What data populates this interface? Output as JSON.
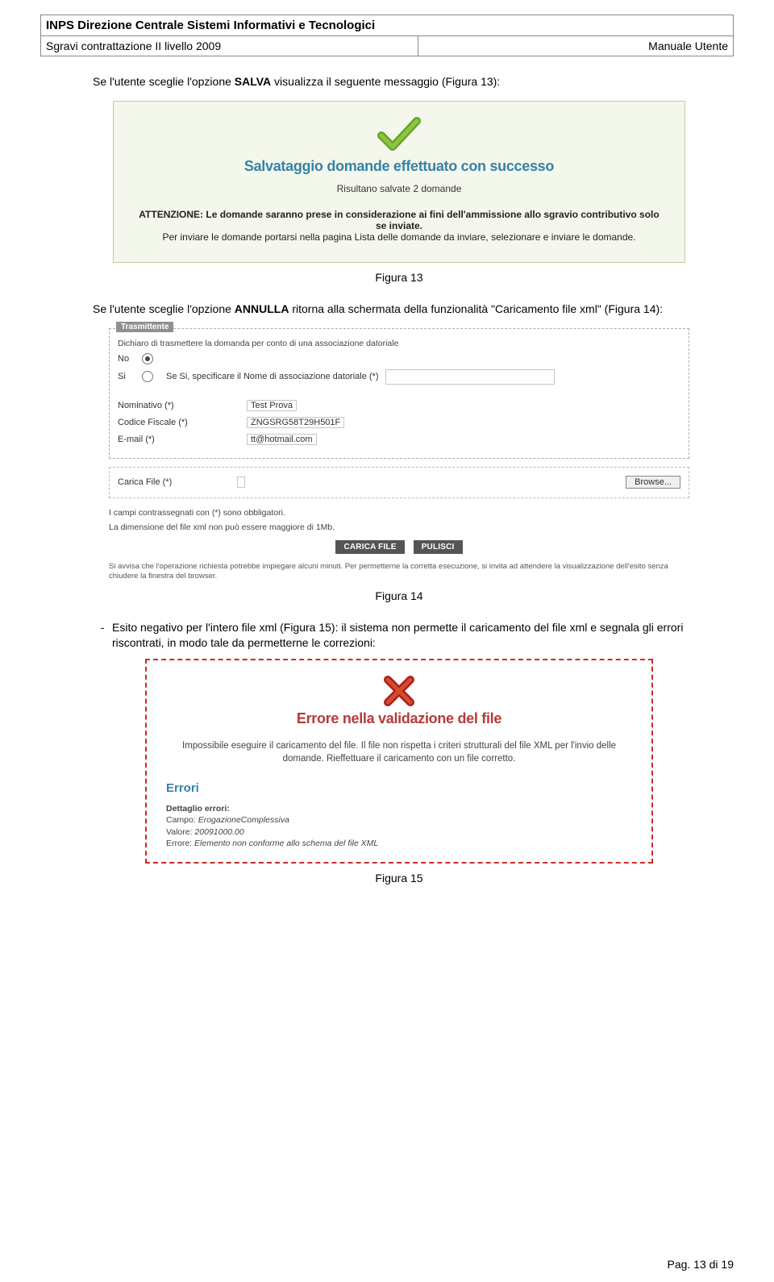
{
  "header": {
    "org": "INPS Direzione Centrale Sistemi Informativi e Tecnologici",
    "left": "Sgravi contrattazione II livello 2009",
    "right": "Manuale Utente"
  },
  "intro_before_bold": "Se l'utente sceglie l'opzione ",
  "intro_bold": "SALVA",
  "intro_after_bold": " visualizza il seguente messaggio (Figura 13):",
  "success": {
    "title": "Salvataggio domande effettuato con successo",
    "sub": "Risultano salvate 2 domande",
    "note_bold": "ATTENZIONE: Le domande saranno prese in considerazione ai fini dell'ammissione allo sgravio contributivo solo se inviate.",
    "note_rest": "Per inviare le domande portarsi nella pagina Lista delle domande da inviare, selezionare e inviare le domande."
  },
  "fig13": "Figura 13",
  "para2_before": "Se l'utente sceglie l'opzione ",
  "para2_bold": "ANNULLA",
  "para2_after": " ritorna alla schermata della funzionalità \"Caricamento file xml\" (Figura 14):",
  "form": {
    "legend": "Trasmittente",
    "decl": "Dichiaro di trasmettere la domanda per conto di una associazione datoriale",
    "no": "No",
    "si": "Si",
    "si_note": "Se Si, specificare il Nome di associazione datoriale (*)",
    "nominativo_label": "Nominativo (*)",
    "nominativo_value": "Test Prova",
    "cf_label": "Codice Fiscale (*)",
    "cf_value": "ZNGSRG58T29H501F",
    "email_label": "E-mail (*)",
    "email_value": "tt@hotmail.com",
    "carica_label": "Carica File (*)",
    "browse": "Browse...",
    "mandatory": "I campi contrassegnati con (*) sono obbligatori.",
    "maxsize": "La dimensione del file xml non può essere maggiore di 1Mb.",
    "btn_load": "CARICA FILE",
    "btn_clear": "PULISCI",
    "warn": "Si avvisa che l'operazione richiesta potrebbe impiegare alcuni minuti. Per permetterne la corretta esecuzione, si invita ad attendere la visualizzazione dell'esito senza chiudere la finestra del browser."
  },
  "fig14": "Figura 14",
  "bullet": {
    "bold": "Esito negativo per l'intero file xml",
    "rest": " (Figura 15): il sistema non permette il caricamento del file xml e segnala gli errori riscontrati, in modo tale da permetterne le correzioni:"
  },
  "error": {
    "title": "Errore nella validazione del file",
    "sub": "Impossibile eseguire il caricamento del file. Il file non rispetta i criteri strutturali del file XML per l'invio delle domande. Rieffettuare il caricamento con un file corretto.",
    "errors_heading": "Errori",
    "detail_label": "Dettaglio errori:",
    "campo_k": "Campo:",
    "campo_v": "ErogazioneComplessiva",
    "valore_k": "Valore:",
    "valore_v": "20091000.00",
    "errore_k": "Errore:",
    "errore_v": "Elemento non conforme allo schema del file XML"
  },
  "fig15": "Figura 15",
  "footer": "Pag. 13 di 19"
}
